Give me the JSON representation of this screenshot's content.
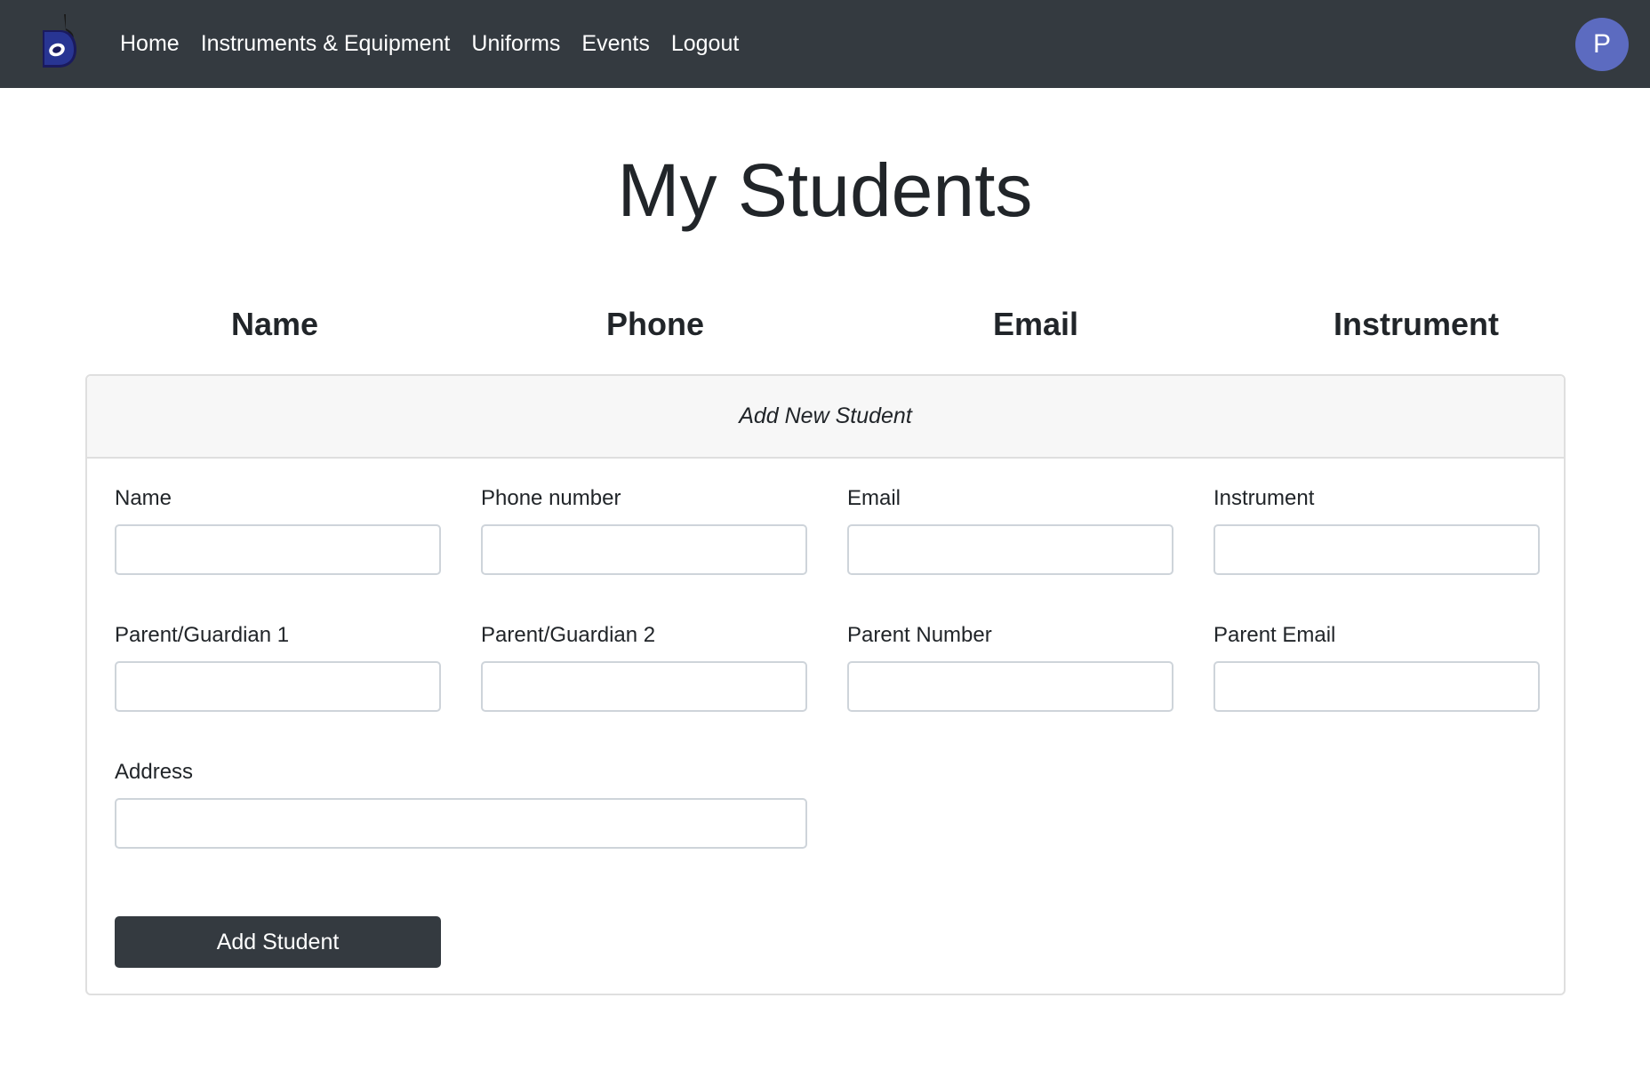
{
  "nav": {
    "logo_icon": "music-note-d-logo-icon",
    "links": [
      "Home",
      "Instruments & Equipment",
      "Uniforms",
      "Events",
      "Logout"
    ],
    "avatar_initial": "P",
    "colors": {
      "background": "#343a40",
      "avatar": "#5c6bc0"
    }
  },
  "page": {
    "title": "My Students"
  },
  "table": {
    "headers": [
      "Name",
      "Phone",
      "Email",
      "Instrument"
    ]
  },
  "form": {
    "header": "Add New Student",
    "fields": {
      "name": {
        "label": "Name",
        "value": ""
      },
      "phone": {
        "label": "Phone number",
        "value": ""
      },
      "email": {
        "label": "Email",
        "value": ""
      },
      "instrument": {
        "label": "Instrument",
        "value": ""
      },
      "parent1": {
        "label": "Parent/Guardian 1",
        "value": ""
      },
      "parent2": {
        "label": "Parent/Guardian 2",
        "value": ""
      },
      "parent_number": {
        "label": "Parent Number",
        "value": ""
      },
      "parent_email": {
        "label": "Parent Email",
        "value": ""
      },
      "address": {
        "label": "Address",
        "value": ""
      }
    },
    "submit_label": "Add Student"
  }
}
